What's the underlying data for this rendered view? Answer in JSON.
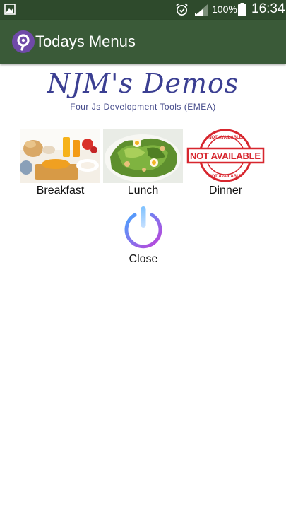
{
  "status_bar": {
    "battery_percent": "100%",
    "time": "16:34",
    "icons": [
      "notification-image-icon",
      "alarm-icon",
      "signal-icon",
      "battery-icon"
    ]
  },
  "app_bar": {
    "title": "Todays Menus",
    "icon": "app-logo-icon"
  },
  "logo": {
    "title": "NJM's Demos",
    "tagline": "Four Js Development Tools (EMEA)"
  },
  "menus": [
    {
      "label": "Breakfast",
      "image": "breakfast-photo"
    },
    {
      "label": "Lunch",
      "image": "salad-photo"
    },
    {
      "label": "Dinner",
      "image": "not-available-stamp",
      "stamp_top": "NOT AVAILABLE",
      "stamp_main": "NOT AVAILABLE",
      "stamp_bottom": "NOT AVAILABLE"
    }
  ],
  "close": {
    "label": "Close",
    "icon": "power-icon"
  },
  "colors": {
    "status_bar": "#2e4a2c",
    "app_bar": "#3a5a38",
    "logo_text": "#3b3f92",
    "stamp_red": "#d7262e",
    "power_gradient_start": "#4aa3ff",
    "power_gradient_end": "#c040d8"
  }
}
